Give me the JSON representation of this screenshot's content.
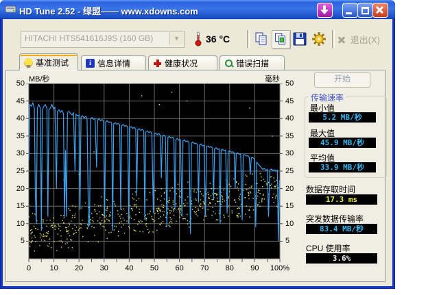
{
  "window": {
    "title": "HD Tune 2.52 - 绿盟—— www.xdowns.com"
  },
  "toolbar": {
    "drive_select": "HITACHI HTS541616J9S (160 GB)",
    "dropdown_arrow": "▼",
    "temperature": "36 °C",
    "exit_label": "退出(X)"
  },
  "tabs": [
    {
      "label": "基准测试",
      "icon": "benchmark-icon",
      "active": true
    },
    {
      "label": "信息详情",
      "icon": "info-icon",
      "active": false
    },
    {
      "label": "健康状况",
      "icon": "health-icon",
      "active": false
    },
    {
      "label": "错误扫描",
      "icon": "scan-icon",
      "active": false
    }
  ],
  "side_panel": {
    "start_button": "开始",
    "transfer_group_title": "传输速率",
    "min_label": "最小值",
    "min_value": "5.2 MB/秒",
    "max_label": "最大值",
    "max_value": "45.9 MB/秒",
    "avg_label": "平均值",
    "avg_value": "33.9 MB/秒",
    "access_label": "数据存取时间",
    "access_value": "17.3 ms",
    "burst_label": "突发数据传输率",
    "burst_value": "83.4 MB/秒",
    "cpu_label": "CPU 使用率",
    "cpu_value": "3.6%"
  },
  "colors": {
    "plot_bg": "#000000",
    "grid": "#6e6e6e",
    "line": "#3ba2f0",
    "scatter": "#e4e45a",
    "lcd_cyan": "#38b4f0",
    "lcd_yellow": "#e8e838",
    "lcd_white": "#f0f0f0",
    "titlebar_blue": "#2a62e0",
    "client_beige": "#ece9d8"
  },
  "chart_data": {
    "type": "line+scatter",
    "left_axis_label": "MB/秒",
    "right_axis_label": "毫秒",
    "xlim": [
      0,
      100
    ],
    "ylim": [
      0,
      50
    ],
    "grid": true,
    "y_ticks": [
      50,
      45,
      40,
      35,
      30,
      25,
      20,
      15,
      10,
      5
    ],
    "x_ticks": [
      0,
      10,
      20,
      30,
      40,
      50,
      60,
      70,
      80,
      90,
      100
    ],
    "x_tick_labels": [
      "0",
      "10",
      "20",
      "30",
      "40",
      "50",
      "60",
      "70",
      "80",
      "90",
      "100%"
    ],
    "series": [
      {
        "name": "传输速率 (MB/秒)",
        "type": "line",
        "color": "#3ba2f0",
        "points": [
          [
            0,
            28
          ],
          [
            0.4,
            44
          ],
          [
            1,
            43.5
          ],
          [
            1.6,
            44.5
          ],
          [
            2.2,
            43
          ],
          [
            2.6,
            18
          ],
          [
            3,
            10
          ],
          [
            3.4,
            43
          ],
          [
            4,
            44
          ],
          [
            4.6,
            43
          ],
          [
            5,
            8
          ],
          [
            5.4,
            42.5
          ],
          [
            6,
            43.5
          ],
          [
            6.6,
            44
          ],
          [
            7.2,
            43
          ],
          [
            7.6,
            12
          ],
          [
            8,
            42.5
          ],
          [
            8.6,
            43
          ],
          [
            9.2,
            44
          ],
          [
            9.8,
            42.8
          ],
          [
            10.4,
            43.2
          ],
          [
            11,
            20
          ],
          [
            11.4,
            42
          ],
          [
            12,
            42.5
          ],
          [
            12.6,
            41.8
          ],
          [
            13.2,
            42.3
          ],
          [
            13.8,
            41.5
          ],
          [
            14.2,
            12
          ],
          [
            14.6,
            31
          ],
          [
            15,
            12
          ],
          [
            15.4,
            41.8
          ],
          [
            16,
            42
          ],
          [
            16.6,
            41.5
          ],
          [
            17.2,
            41
          ],
          [
            17.8,
            41.6
          ],
          [
            18.4,
            25
          ],
          [
            18.8,
            41.2
          ],
          [
            19.4,
            40.8
          ],
          [
            20,
            41
          ],
          [
            20.4,
            14
          ],
          [
            20.8,
            40.5
          ],
          [
            21.4,
            40.8
          ],
          [
            22,
            40.2
          ],
          [
            22.6,
            40.6
          ],
          [
            23.2,
            40
          ],
          [
            23.8,
            9
          ],
          [
            24.2,
            10
          ],
          [
            24.6,
            40
          ],
          [
            25.2,
            40.3
          ],
          [
            25.8,
            39.8
          ],
          [
            26.4,
            40
          ],
          [
            27,
            26
          ],
          [
            27.4,
            39.6
          ],
          [
            28,
            39.9
          ],
          [
            28.6,
            39.4
          ],
          [
            29.2,
            39.7
          ],
          [
            29.8,
            39.2
          ],
          [
            30.2,
            12
          ],
          [
            30.6,
            39
          ],
          [
            31.2,
            39.4
          ],
          [
            31.8,
            38.9
          ],
          [
            32.4,
            39.1
          ],
          [
            33,
            38.7
          ],
          [
            33.4,
            8
          ],
          [
            33.8,
            38.5
          ],
          [
            34.4,
            38.8
          ],
          [
            35,
            38.4
          ],
          [
            35.6,
            38.6
          ],
          [
            36.2,
            38.2
          ],
          [
            36.6,
            14
          ],
          [
            37,
            38
          ],
          [
            37.6,
            38.3
          ],
          [
            38.2,
            37.8
          ],
          [
            38.8,
            38
          ],
          [
            39.4,
            37.6
          ],
          [
            39.8,
            10
          ],
          [
            40.2,
            37.4
          ],
          [
            40.8,
            37.7
          ],
          [
            41.4,
            37.2
          ],
          [
            42,
            37.5
          ],
          [
            42.6,
            37
          ],
          [
            43,
            18
          ],
          [
            43.4,
            36.8
          ],
          [
            44,
            37.1
          ],
          [
            44.6,
            36.6
          ],
          [
            45.2,
            36.9
          ],
          [
            45.8,
            36.4
          ],
          [
            46.2,
            11
          ],
          [
            46.6,
            36.2
          ],
          [
            47.2,
            36.5
          ],
          [
            47.8,
            36
          ],
          [
            48.4,
            36.3
          ],
          [
            49,
            35.8
          ],
          [
            49.6,
            13
          ],
          [
            50,
            35.6
          ],
          [
            50.6,
            35.9
          ],
          [
            51.2,
            35.4
          ],
          [
            51.8,
            35.7
          ],
          [
            52.4,
            35.2
          ],
          [
            52.8,
            23
          ],
          [
            53.2,
            35
          ],
          [
            53.8,
            35.3
          ],
          [
            54.4,
            34.8
          ],
          [
            55,
            9
          ],
          [
            55.4,
            34.6
          ],
          [
            56,
            34.9
          ],
          [
            56.6,
            34.4
          ],
          [
            57.2,
            34.7
          ],
          [
            57.8,
            34.2
          ],
          [
            58.2,
            14
          ],
          [
            58.6,
            34
          ],
          [
            59.2,
            34.3
          ],
          [
            59.8,
            33.8
          ],
          [
            60.4,
            34
          ],
          [
            61,
            12
          ],
          [
            61.4,
            33.6
          ],
          [
            62,
            33.9
          ],
          [
            62.6,
            33.4
          ],
          [
            63.2,
            33.6
          ],
          [
            63.8,
            33.2
          ],
          [
            64.4,
            7
          ],
          [
            64.8,
            33
          ],
          [
            65.4,
            33.3
          ],
          [
            66,
            32.8
          ],
          [
            66.6,
            33
          ],
          [
            67.2,
            32.6
          ],
          [
            67.6,
            16
          ],
          [
            68,
            32.4
          ],
          [
            68.6,
            32.7
          ],
          [
            69.2,
            32.2
          ],
          [
            69.8,
            32.4
          ],
          [
            70.4,
            12
          ],
          [
            70.8,
            32
          ],
          [
            71.4,
            32.2
          ],
          [
            72,
            31.8
          ],
          [
            72.6,
            32
          ],
          [
            73.2,
            31.6
          ],
          [
            73.6,
            17
          ],
          [
            74,
            31.4
          ],
          [
            74.6,
            31.7
          ],
          [
            75.2,
            31.2
          ],
          [
            75.8,
            31.4
          ],
          [
            76.2,
            10
          ],
          [
            76.6,
            31
          ],
          [
            77.2,
            31.2
          ],
          [
            77.8,
            30.8
          ],
          [
            78.4,
            31
          ],
          [
            79,
            13
          ],
          [
            79.4,
            30.6
          ],
          [
            80,
            30.8
          ],
          [
            80.6,
            30.4
          ],
          [
            81.2,
            30.5
          ],
          [
            81.8,
            30.2
          ],
          [
            82.2,
            20
          ],
          [
            82.6,
            30
          ],
          [
            83.2,
            30.2
          ],
          [
            83.8,
            29.8
          ],
          [
            84.4,
            29.9
          ],
          [
            85,
            11
          ],
          [
            85.4,
            29.6
          ],
          [
            86,
            29.7
          ],
          [
            86.6,
            29.3
          ],
          [
            87.2,
            29.4
          ],
          [
            87.8,
            29
          ],
          [
            88.2,
            24
          ],
          [
            88.6,
            28.8
          ],
          [
            89.2,
            28.9
          ],
          [
            89.8,
            28.5
          ],
          [
            90.4,
            9
          ],
          [
            90.8,
            27.5
          ],
          [
            91.4,
            27
          ],
          [
            92,
            26.5
          ],
          [
            92.6,
            26
          ],
          [
            93.2,
            25.5
          ],
          [
            93.8,
            25.8
          ],
          [
            94.4,
            25.2
          ],
          [
            95,
            25.5
          ],
          [
            95.5,
            12
          ],
          [
            96,
            25.3
          ],
          [
            96.6,
            25.6
          ],
          [
            97.2,
            25.2
          ],
          [
            97.8,
            25.4
          ],
          [
            98.4,
            25
          ],
          [
            99,
            25.3
          ],
          [
            99.4,
            5
          ],
          [
            99.8,
            22
          ],
          [
            100,
            22.5
          ]
        ]
      },
      {
        "name": "存取时间 (毫秒)",
        "type": "scatter",
        "color": "#e4e45a",
        "generator": {
          "seed": 7,
          "count": 620,
          "y_base_intercept": 7,
          "y_base_slope": 0.13,
          "spread": 7,
          "y_min": 2.2,
          "y_max": 26
        },
        "outliers": [
          [
            14,
            22.5
          ],
          [
            20,
            24
          ],
          [
            26,
            30.5
          ],
          [
            45,
            46.5
          ],
          [
            52,
            44
          ],
          [
            57,
            47.5
          ],
          [
            63,
            45
          ],
          [
            88,
            43
          ],
          [
            97,
            35
          ]
        ]
      }
    ]
  }
}
